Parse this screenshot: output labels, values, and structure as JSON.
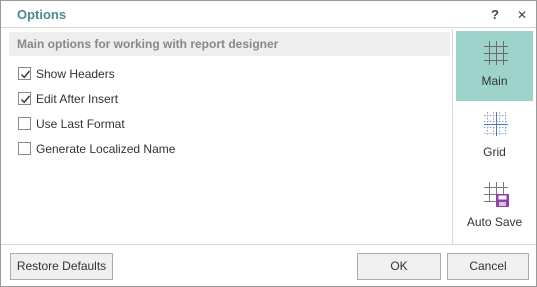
{
  "window": {
    "title": "Options",
    "help_label": "?",
    "close_label": "✕"
  },
  "main": {
    "section_header": "Main options for working with report designer",
    "options": [
      {
        "label": "Show Headers",
        "checked": true
      },
      {
        "label": "Edit After Insert",
        "checked": true
      },
      {
        "label": "Use Last Format",
        "checked": false
      },
      {
        "label": "Generate Localized Name",
        "checked": false
      }
    ]
  },
  "sidebar": {
    "items": [
      {
        "label": "Main",
        "icon": "grid-icon",
        "active": true
      },
      {
        "label": "Grid",
        "icon": "grid-dotted-icon",
        "active": false
      },
      {
        "label": "Auto Save",
        "icon": "grid-save-icon",
        "active": false
      }
    ]
  },
  "footer": {
    "restore_label": "Restore Defaults",
    "ok_label": "OK",
    "cancel_label": "Cancel"
  },
  "colors": {
    "title": "#4a8c8a",
    "active_tab": "#9ed3cc",
    "save_icon": "#8e3fa8"
  }
}
